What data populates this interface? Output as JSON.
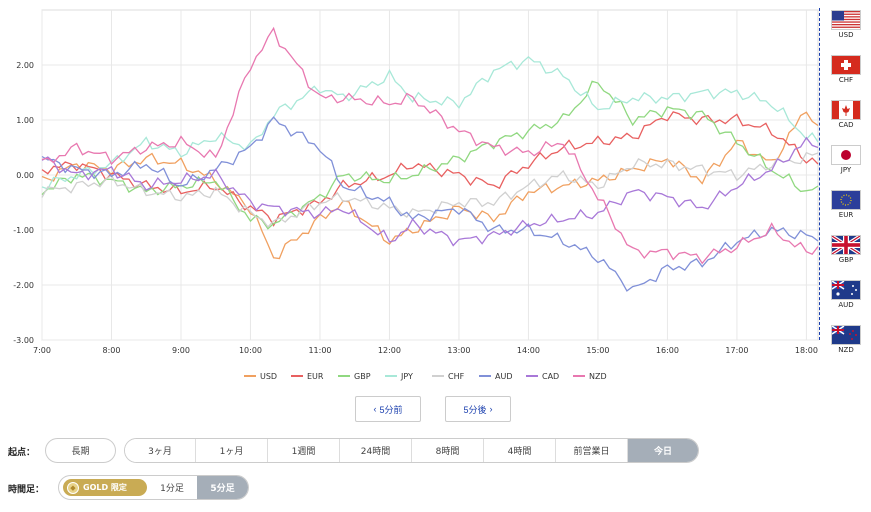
{
  "chart_data": {
    "type": "line",
    "x_ticks": [
      "7:00",
      "8:00",
      "9:00",
      "10:00",
      "11:00",
      "12:00",
      "13:00",
      "14:00",
      "15:00",
      "16:00",
      "17:00",
      "18:00"
    ],
    "xlim": [
      "7:00",
      "18:10"
    ],
    "ylim": [
      -3.0,
      3.0
    ],
    "y_ticks": [
      "2.00",
      "1.00",
      "0.00",
      "-1.00",
      "-2.00",
      "-3.00"
    ],
    "y_tick_values": [
      2,
      1,
      0,
      -1,
      -2,
      -3
    ],
    "grid": true,
    "legend_position": "bottom",
    "series": [
      {
        "name": "USD",
        "color": "#f0a060",
        "x": [
          "7:00",
          "7:30",
          "8:00",
          "8:30",
          "9:00",
          "9:30",
          "10:00",
          "10:20",
          "11:00",
          "11:20",
          "12:00",
          "12:20",
          "13:00",
          "13:30",
          "14:00",
          "14:30",
          "15:00",
          "15:30",
          "16:00",
          "16:30",
          "17:00",
          "17:30",
          "18:00",
          "18:10"
        ],
        "y": [
          -0.1,
          0.2,
          0.1,
          0.3,
          0.2,
          -0.1,
          -0.6,
          -1.5,
          -0.8,
          -0.5,
          -1.2,
          -1.0,
          -0.6,
          -0.8,
          -0.3,
          -0.2,
          -0.1,
          0.1,
          0.3,
          -0.1,
          0.6,
          0.2,
          1.2,
          0.9
        ]
      },
      {
        "name": "EUR",
        "color": "#e86060",
        "x": [
          "7:00",
          "7:30",
          "8:00",
          "8:30",
          "9:00",
          "9:30",
          "10:00",
          "10:20",
          "11:00",
          "11:20",
          "12:00",
          "12:20",
          "13:00",
          "13:30",
          "14:00",
          "14:30",
          "15:00",
          "15:30",
          "16:00",
          "16:30",
          "17:00",
          "17:30",
          "18:00",
          "18:10"
        ],
        "y": [
          0.1,
          0.2,
          0.0,
          -0.2,
          -0.3,
          -0.2,
          -0.6,
          -0.8,
          -0.5,
          -0.2,
          0.0,
          0.2,
          0.0,
          -0.2,
          0.2,
          0.5,
          0.6,
          0.7,
          1.1,
          1.0,
          1.0,
          0.8,
          0.3,
          0.2
        ]
      },
      {
        "name": "GBP",
        "color": "#90d880",
        "x": [
          "7:00",
          "7:30",
          "8:00",
          "8:30",
          "9:00",
          "9:30",
          "10:00",
          "10:20",
          "11:00",
          "11:20",
          "12:00",
          "12:20",
          "13:00",
          "13:30",
          "14:00",
          "14:30",
          "15:00",
          "15:30",
          "16:00",
          "16:30",
          "17:00",
          "17:30",
          "18:00",
          "18:10"
        ],
        "y": [
          -0.3,
          0.0,
          -0.1,
          -0.3,
          -0.2,
          -0.1,
          -0.8,
          -0.9,
          -0.4,
          0.0,
          -0.1,
          0.0,
          0.3,
          0.6,
          0.8,
          1.0,
          1.7,
          1.0,
          1.2,
          1.1,
          0.6,
          0.1,
          -0.3,
          -0.2
        ]
      },
      {
        "name": "JPY",
        "color": "#a8e8d8",
        "x": [
          "7:00",
          "7:30",
          "8:00",
          "8:30",
          "9:00",
          "9:30",
          "10:00",
          "10:20",
          "11:00",
          "11:20",
          "12:00",
          "12:20",
          "13:00",
          "13:30",
          "14:00",
          "14:30",
          "15:00",
          "15:30",
          "16:00",
          "16:30",
          "17:00",
          "17:30",
          "18:00",
          "18:10"
        ],
        "y": [
          -0.2,
          0.0,
          0.2,
          0.6,
          0.4,
          0.7,
          0.5,
          1.1,
          1.6,
          1.4,
          1.8,
          1.4,
          1.3,
          1.9,
          2.1,
          1.8,
          1.2,
          1.4,
          1.4,
          1.5,
          1.5,
          1.3,
          0.7,
          0.6
        ]
      },
      {
        "name": "CHF",
        "color": "#d0d0d0",
        "x": [
          "7:00",
          "7:30",
          "8:00",
          "8:30",
          "9:00",
          "9:30",
          "10:00",
          "10:20",
          "11:00",
          "11:20",
          "12:00",
          "12:20",
          "13:00",
          "13:30",
          "14:00",
          "14:30",
          "15:00",
          "15:30",
          "16:00",
          "16:30",
          "17:00",
          "17:30",
          "18:00",
          "18:10"
        ],
        "y": [
          -0.3,
          -0.2,
          -0.1,
          -0.3,
          -0.4,
          -0.3,
          -0.7,
          -0.9,
          -0.5,
          -0.4,
          -0.6,
          -0.7,
          -0.5,
          -0.5,
          -0.2,
          0.0,
          -0.2,
          0.2,
          0.2,
          0.1,
          0.0,
          0.2,
          0.3,
          0.4
        ]
      },
      {
        "name": "AUD",
        "color": "#8090d8",
        "x": [
          "7:00",
          "7:30",
          "8:00",
          "8:30",
          "9:00",
          "9:30",
          "10:00",
          "10:20",
          "11:00",
          "11:20",
          "12:00",
          "12:20",
          "13:00",
          "13:30",
          "14:00",
          "14:30",
          "15:00",
          "15:30",
          "16:00",
          "16:30",
          "17:00",
          "17:30",
          "18:00",
          "18:10"
        ],
        "y": [
          0.3,
          0.1,
          0.0,
          0.2,
          -0.2,
          0.1,
          0.5,
          1.0,
          0.5,
          -0.2,
          -0.5,
          -0.8,
          -0.6,
          -1.0,
          -1.0,
          -1.2,
          -1.5,
          -2.1,
          -1.7,
          -1.6,
          -1.2,
          -1.0,
          -1.1,
          -1.2
        ]
      },
      {
        "name": "CAD",
        "color": "#a878d8",
        "x": [
          "7:00",
          "7:30",
          "8:00",
          "8:30",
          "9:00",
          "9:30",
          "10:00",
          "10:20",
          "11:00",
          "11:20",
          "12:00",
          "12:20",
          "13:00",
          "13:30",
          "14:00",
          "14:30",
          "15:00",
          "15:30",
          "16:00",
          "16:30",
          "17:00",
          "17:30",
          "18:00",
          "18:10"
        ],
        "y": [
          0.3,
          0.0,
          0.1,
          -0.2,
          -0.1,
          0.0,
          -0.5,
          -0.6,
          -0.7,
          -0.6,
          -1.2,
          -0.9,
          -1.2,
          -1.1,
          -0.9,
          -0.8,
          -0.7,
          -0.3,
          -0.4,
          -0.6,
          -0.2,
          0.1,
          0.6,
          0.5
        ]
      },
      {
        "name": "NZD",
        "color": "#e878b0",
        "x": [
          "7:00",
          "7:30",
          "8:00",
          "8:30",
          "9:00",
          "9:30",
          "10:00",
          "10:20",
          "11:00",
          "11:20",
          "12:00",
          "12:20",
          "13:00",
          "13:30",
          "14:00",
          "14:30",
          "15:00",
          "15:30",
          "16:00",
          "16:30",
          "17:00",
          "17:30",
          "18:00",
          "18:10"
        ],
        "y": [
          0.2,
          0.5,
          0.3,
          0.5,
          0.6,
          0.3,
          2.0,
          2.6,
          1.4,
          1.4,
          1.3,
          1.4,
          0.8,
          0.5,
          0.4,
          0.6,
          -0.4,
          -1.4,
          -1.4,
          -1.5,
          -1.3,
          -1.0,
          -1.4,
          -1.3
        ]
      }
    ]
  },
  "flags": [
    {
      "code": "USD",
      "icon": "us-flag-icon"
    },
    {
      "code": "CHF",
      "icon": "swiss-flag-icon"
    },
    {
      "code": "CAD",
      "icon": "canada-flag-icon"
    },
    {
      "code": "JPY",
      "icon": "japan-flag-icon"
    },
    {
      "code": "EUR",
      "icon": "eu-flag-icon"
    },
    {
      "code": "GBP",
      "icon": "uk-flag-icon"
    },
    {
      "code": "AUD",
      "icon": "australia-flag-icon"
    },
    {
      "code": "NZD",
      "icon": "newzealand-flag-icon"
    }
  ],
  "nav": {
    "prev": "5分前",
    "next": "5分後",
    "prev_icon": "chevron-left-icon",
    "next_icon": "chevron-right-icon"
  },
  "start": {
    "label": "起点：",
    "long_term": "長期",
    "options": [
      "3ヶ月",
      "1ヶ月",
      "1週間",
      "24時間",
      "8時間",
      "4時間",
      "前営業日",
      "今日"
    ],
    "selected": "今日"
  },
  "timeframe": {
    "label": "時間足：",
    "gold": "GOLD 限定",
    "one_min": "1分足",
    "five_min": "5分足",
    "selected": "5分足"
  }
}
